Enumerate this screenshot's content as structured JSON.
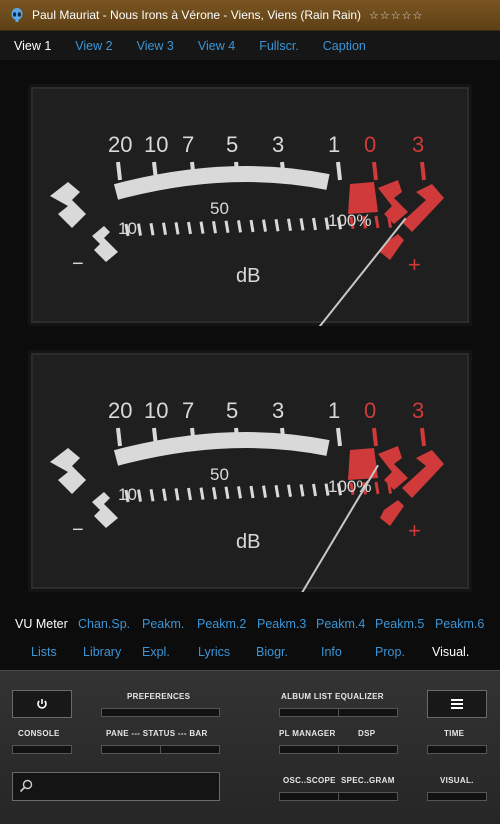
{
  "window": {
    "title": "Paul Mauriat - Nous Irons à Vérone - Viens, Viens (Rain Rain)",
    "rating_stars": "☆☆☆☆☆",
    "icon": "alien-head-icon"
  },
  "view_tabs": [
    "View 1",
    "View 2",
    "View 3",
    "View 4",
    "Fullscr.",
    "Caption"
  ],
  "view_tabs_active": 0,
  "meters": {
    "top_scale": [
      "20",
      "10",
      "7",
      "5",
      "3",
      "1",
      "0",
      "3"
    ],
    "mid_labels": [
      "10",
      "50",
      "100%"
    ],
    "unit": "dB",
    "minus": "−",
    "plus": "+",
    "needle_levels": {
      "upper": 0.85,
      "lower": 0.78
    }
  },
  "panel_tabs_row1": [
    "VU Meter",
    "Chan.Sp.",
    "Peakm.",
    "Peakm.2",
    "Peakm.3",
    "Peakm.4",
    "Peakm.5",
    "Peakm.6"
  ],
  "panel_tabs_row1_active": 0,
  "panel_tabs_row2": [
    "Lists",
    "Library",
    "Expl.",
    "Lyrics",
    "Biogr.",
    "Info",
    "Prop.",
    "Visual."
  ],
  "panel_tabs_row2_active": 7,
  "controls": {
    "power_icon": "power-icon",
    "menu_icon": "hamburger-menu-icon",
    "search_icon": "search-icon",
    "labels": {
      "console": "CONSOLE",
      "preferences": "PREFERENCES",
      "pane_status_bar": "PANE --- STATUS --- BAR",
      "album_list_equalizer": "ALBUM LIST  EQUALIZER",
      "pl_manager": "PL MANAGER",
      "dsp": "DSP",
      "time": "TIME",
      "osc_scope": "OSC..SCOPE",
      "spec_gram": "SPEC..GRAM",
      "visual": "VISUAL."
    }
  },
  "colors": {
    "accent_blue": "#3b95d6",
    "meter_red": "#d03a3a",
    "meter_white": "#d9d9d9",
    "title_bar": "#6b4a1b"
  }
}
